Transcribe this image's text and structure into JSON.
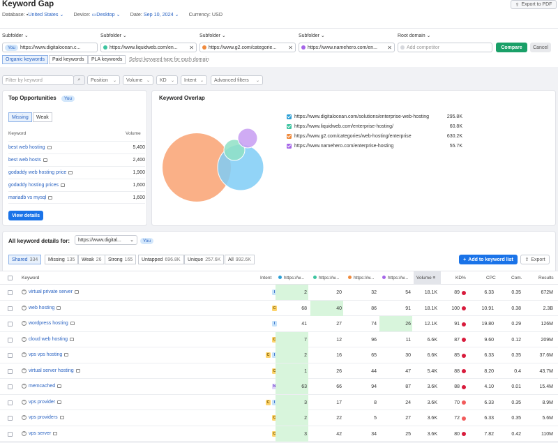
{
  "header": {
    "title": "Keyword Gap",
    "database_label": "Database:",
    "database_value": "United States",
    "device_label": "Device:",
    "device_value": "Desktop",
    "date_label": "Date:",
    "date_value": "Sep 10, 2024",
    "currency_label": "Currency:",
    "currency_value": "USD",
    "export_pdf": "Export to PDF"
  },
  "domains": {
    "subfolder_label": "Subfolder",
    "root_domain_label": "Root domain",
    "you_badge": "You",
    "inputs": [
      {
        "value": "https://www.digitalocean.c...",
        "color": "#2a9fd6"
      },
      {
        "value": "https://www.liquidweb.com/en...",
        "color": "#3cc4a0"
      },
      {
        "value": "https://www.g2.com/categorie...",
        "color": "#f08a3c"
      },
      {
        "value": "https://www.namehero.com/en...",
        "color": "#a566e8"
      }
    ],
    "add_placeholder": "Add competitor",
    "compare": "Compare",
    "cancel": "Cancel"
  },
  "keyword_types": {
    "items": [
      "Organic keywords",
      "Paid keywords",
      "PLA keywords"
    ],
    "hint": "Select keyword type for each domain"
  },
  "filters": {
    "search_placeholder": "Filter by keyword",
    "position": "Position",
    "volume": "Volume",
    "kd": "KD",
    "intent": "Intent",
    "advanced": "Advanced filters"
  },
  "top_opportunities": {
    "title": "Top Opportunities",
    "you_badge": "You",
    "toggle_missing": "Missing",
    "toggle_weak": "Weak",
    "col_keyword": "Keyword",
    "col_volume": "Volume",
    "rows": [
      {
        "keyword": "best web hosting",
        "volume": "5,400"
      },
      {
        "keyword": "best web hosts",
        "volume": "2,400"
      },
      {
        "keyword": "godaddy web hosting price",
        "volume": "1,900"
      },
      {
        "keyword": "godaddy hosting prices",
        "volume": "1,600"
      },
      {
        "keyword": "mariadb vs mysql",
        "volume": "1,600"
      }
    ],
    "view_details": "View details"
  },
  "keyword_overlap": {
    "title": "Keyword Overlap",
    "legend": [
      {
        "url": "https://www.digitalocean.com/solutions/enterprise-web-hosting",
        "count": "295.8K",
        "color": "#2a9fd6"
      },
      {
        "url": "https://www.liquidweb.com/enterprise-hosting/",
        "count": "60.8K",
        "color": "#3cc4a0"
      },
      {
        "url": "https://www.g2.com/categories/web-hosting/enterprise",
        "count": "630.2K",
        "color": "#f08a3c"
      },
      {
        "url": "https://www.namehero.com/enterprise-hosting",
        "count": "55.7K",
        "color": "#a566e8"
      }
    ]
  },
  "all_keywords": {
    "label": "All keyword details for:",
    "domain_select": "https://www.digital...",
    "you_badge": "You",
    "tabs": [
      {
        "label": "Shared",
        "count": "334"
      },
      {
        "label": "Missing",
        "count": "135"
      },
      {
        "label": "Weak",
        "count": "26"
      },
      {
        "label": "Strong",
        "count": "165"
      },
      {
        "label": "Untapped",
        "count": "696.8K"
      },
      {
        "label": "Unique",
        "count": "257.6K"
      },
      {
        "label": "All",
        "count": "992.6K"
      }
    ],
    "add_to_list": "Add to keyword list",
    "export": "Export"
  },
  "table": {
    "headers": {
      "keyword": "Keyword",
      "intent": "Intent",
      "d1": "https://w...",
      "d2": "https://w...",
      "d3": "https://w...",
      "d4": "https://w...",
      "volume": "Volume",
      "kd": "KD%",
      "cpc": "CPC",
      "com": "Com.",
      "results": "Results"
    },
    "rows": [
      {
        "keyword": "virtual private server",
        "intent": [
          "I"
        ],
        "d1": "2",
        "d2": "20",
        "d3": "32",
        "d4": "54",
        "volume": "18.1K",
        "kd": "89",
        "kd_color": "#d81b3c",
        "cpc": "6.33",
        "com": "0.35",
        "results": "672M",
        "hl": "d1"
      },
      {
        "keyword": "web hosting",
        "intent": [
          "C"
        ],
        "d1": "68",
        "d2": "40",
        "d3": "86",
        "d4": "91",
        "volume": "18.1K",
        "kd": "100",
        "kd_color": "#d81b3c",
        "cpc": "10.91",
        "com": "0.38",
        "results": "2.3B",
        "hl": "d2"
      },
      {
        "keyword": "wordpress hosting",
        "intent": [
          "I"
        ],
        "d1": "41",
        "d2": "27",
        "d3": "74",
        "d4": "26",
        "volume": "12.1K",
        "kd": "91",
        "kd_color": "#d81b3c",
        "cpc": "19.80",
        "com": "0.29",
        "results": "126M",
        "hl": "d4"
      },
      {
        "keyword": "cloud web hosting",
        "intent": [
          "C"
        ],
        "d1": "7",
        "d2": "12",
        "d3": "96",
        "d4": "11",
        "volume": "6.6K",
        "kd": "87",
        "kd_color": "#d81b3c",
        "cpc": "9.60",
        "com": "0.12",
        "results": "209M",
        "hl": "d1"
      },
      {
        "keyword": "vps vps hosting",
        "intent": [
          "C",
          "I"
        ],
        "d1": "2",
        "d2": "16",
        "d3": "65",
        "d4": "30",
        "volume": "6.6K",
        "kd": "85",
        "kd_color": "#d81b3c",
        "cpc": "6.33",
        "com": "0.35",
        "results": "37.6M",
        "hl": "d1"
      },
      {
        "keyword": "virtual server hosting",
        "intent": [
          "C"
        ],
        "d1": "1",
        "d2": "26",
        "d3": "44",
        "d4": "47",
        "volume": "5.4K",
        "kd": "88",
        "kd_color": "#d81b3c",
        "cpc": "8.20",
        "com": "0.4",
        "results": "43.7M",
        "hl": "d1"
      },
      {
        "keyword": "memcached",
        "intent": [
          "N"
        ],
        "d1": "63",
        "d2": "66",
        "d3": "94",
        "d4": "87",
        "volume": "3.6K",
        "kd": "88",
        "kd_color": "#d81b3c",
        "cpc": "4.10",
        "com": "0.01",
        "results": "15.4M",
        "hl": "d1"
      },
      {
        "keyword": "vps provider",
        "intent": [
          "C",
          "I"
        ],
        "d1": "3",
        "d2": "17",
        "d3": "8",
        "d4": "24",
        "volume": "3.6K",
        "kd": "70",
        "kd_color": "#f25b5b",
        "cpc": "6.33",
        "com": "0.35",
        "results": "8.9M",
        "hl": "d1"
      },
      {
        "keyword": "vps providers",
        "intent": [
          "C"
        ],
        "d1": "2",
        "d2": "22",
        "d3": "5",
        "d4": "27",
        "volume": "3.6K",
        "kd": "72",
        "kd_color": "#f25b5b",
        "cpc": "6.33",
        "com": "0.35",
        "results": "5.6M",
        "hl": "d1"
      },
      {
        "keyword": "vps server",
        "intent": [
          "C"
        ],
        "d1": "3",
        "d2": "42",
        "d3": "34",
        "d4": "25",
        "volume": "3.6K",
        "kd": "80",
        "kd_color": "#d81b3c",
        "cpc": "7.82",
        "com": "0.42",
        "results": "110M",
        "hl": "d1"
      }
    ]
  }
}
